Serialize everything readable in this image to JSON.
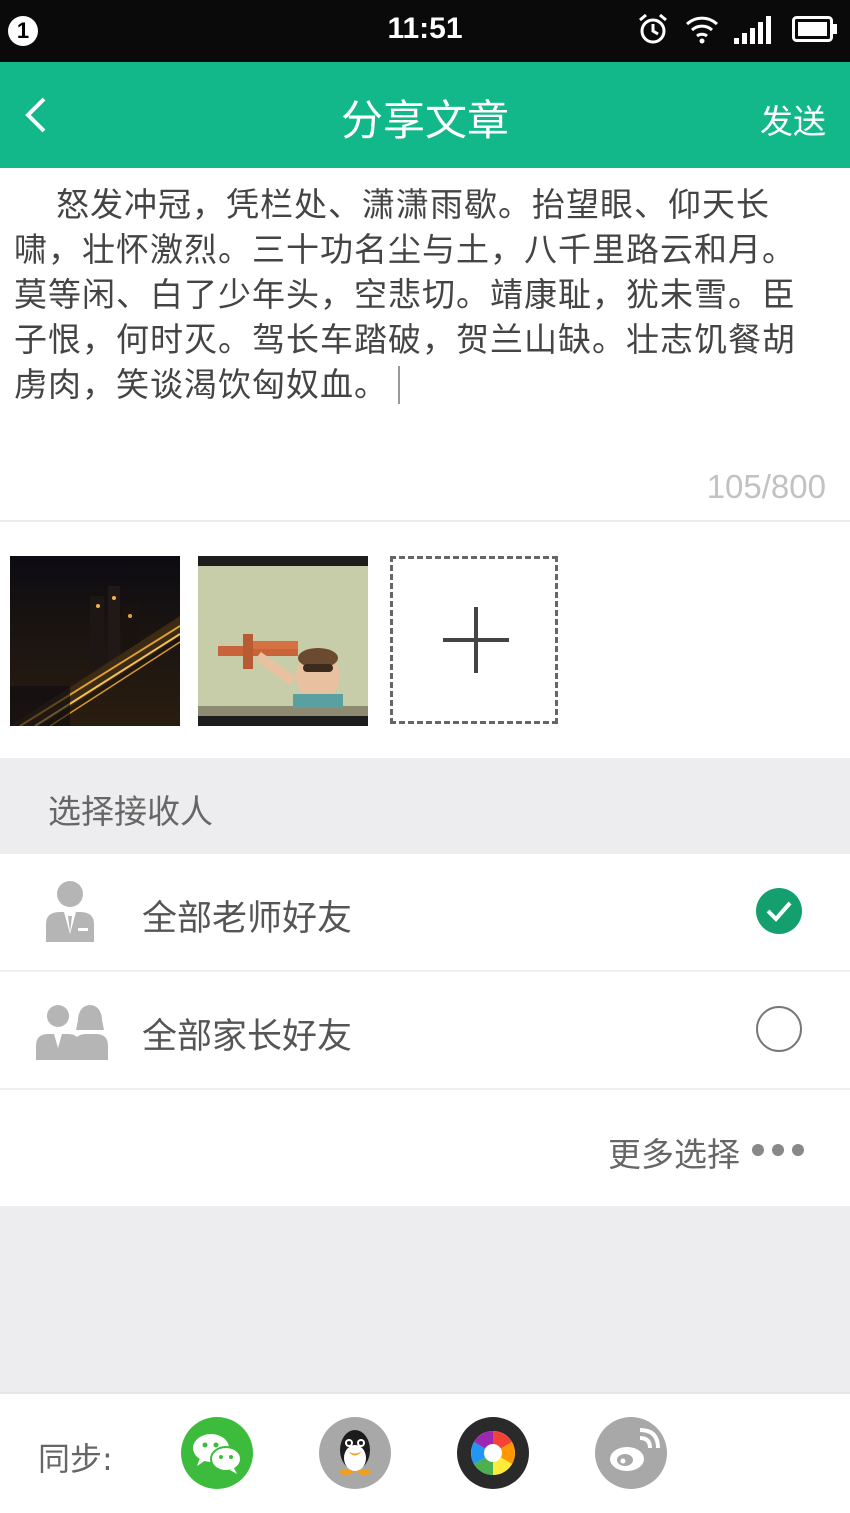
{
  "status_bar": {
    "notification_count": "1",
    "time": "11:51"
  },
  "header": {
    "title": "分享文章",
    "send_label": "发送"
  },
  "editor": {
    "content": "怒发冲冠，凭栏处、潇潇雨歇。抬望眼、仰天长啸，壮怀激烈。三十功名尘与土，八千里路云和月。莫等闲、白了少年头，空悲切。靖康耻，犹未雪。臣子恨，何时灭。驾长车踏破，贺兰山缺。壮志饥餐胡虏肉，笑谈渴饮匈奴血。",
    "counter": "105/800"
  },
  "recipients": {
    "section_label": "选择接收人",
    "options": [
      {
        "label": "全部老师好友",
        "checked": true
      },
      {
        "label": "全部家长好友",
        "checked": false
      }
    ],
    "more_label": "更多选择"
  },
  "footer": {
    "sync_label": "同步:",
    "targets": [
      "wechat-icon",
      "qq-icon",
      "camera-aperture-icon",
      "weibo-icon"
    ]
  },
  "colors": {
    "accent": "#13b88a",
    "check": "#13a06e",
    "wechat": "#3dbb3d"
  }
}
